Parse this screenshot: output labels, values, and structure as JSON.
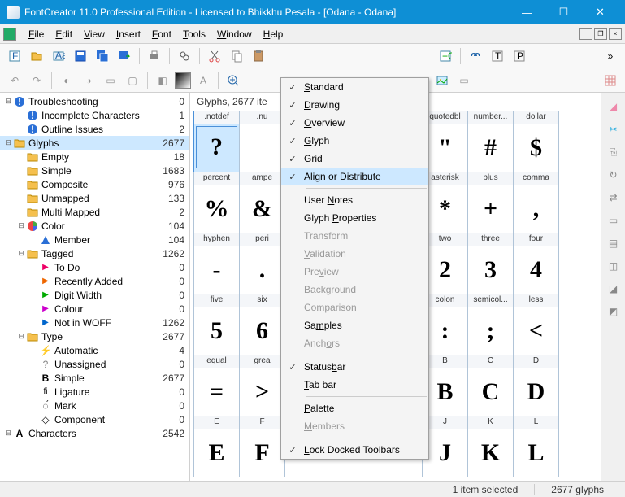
{
  "title": "FontCreator 11.0 Professional Edition - Licensed to Bhikkhu Pesala - [Odana - Odana]",
  "menu": [
    "File",
    "Edit",
    "View",
    "Insert",
    "Font",
    "Tools",
    "Window",
    "Help"
  ],
  "glyphHeader": "Glyphs, 2677 ite",
  "tree": [
    {
      "d": 0,
      "e": "-",
      "i": "info",
      "l": "Troubleshooting",
      "c": 0
    },
    {
      "d": 1,
      "e": "",
      "i": "info",
      "l": "Incomplete Characters",
      "c": 1
    },
    {
      "d": 1,
      "e": "",
      "i": "info",
      "l": "Outline Issues",
      "c": 2
    },
    {
      "d": 0,
      "e": "-",
      "i": "folder",
      "l": "Glyphs",
      "c": 2677,
      "sel": true
    },
    {
      "d": 1,
      "e": "",
      "i": "folder",
      "l": "Empty",
      "c": 18
    },
    {
      "d": 1,
      "e": "",
      "i": "folder",
      "l": "Simple",
      "c": 1683
    },
    {
      "d": 1,
      "e": "",
      "i": "folder",
      "l": "Composite",
      "c": 976
    },
    {
      "d": 1,
      "e": "",
      "i": "folder",
      "l": "Unmapped",
      "c": 133
    },
    {
      "d": 1,
      "e": "",
      "i": "folder",
      "l": "Multi Mapped",
      "c": 2
    },
    {
      "d": 1,
      "e": "-",
      "i": "pie",
      "l": "Color",
      "c": 104
    },
    {
      "d": 2,
      "e": "",
      "i": "tri",
      "l": "Member",
      "c": 104
    },
    {
      "d": 1,
      "e": "-",
      "i": "folder",
      "l": "Tagged",
      "c": 1262
    },
    {
      "d": 2,
      "e": "",
      "i": "flag",
      "fc": "#e06",
      "l": "To Do",
      "c": 0
    },
    {
      "d": 2,
      "e": "",
      "i": "flag",
      "fc": "#e60",
      "l": "Recently Added",
      "c": 0
    },
    {
      "d": 2,
      "e": "",
      "i": "flag",
      "fc": "#0a0",
      "l": "Digit Width",
      "c": 0
    },
    {
      "d": 2,
      "e": "",
      "i": "flag",
      "fc": "#c0c",
      "l": "Colour",
      "c": 0
    },
    {
      "d": 2,
      "e": "",
      "i": "flag",
      "fc": "#06c",
      "l": "Not in WOFF",
      "c": 1262
    },
    {
      "d": 1,
      "e": "-",
      "i": "folder",
      "l": "Type",
      "c": 2677
    },
    {
      "d": 2,
      "e": "",
      "i": "bolt",
      "l": "Automatic",
      "c": 4
    },
    {
      "d": 2,
      "e": "",
      "i": "q",
      "l": "Unassigned",
      "c": 0
    },
    {
      "d": 2,
      "e": "",
      "i": "B",
      "l": "Simple",
      "c": 2677
    },
    {
      "d": 2,
      "e": "",
      "i": "fi",
      "l": "Ligature",
      "c": 0
    },
    {
      "d": 2,
      "e": "",
      "i": "mk",
      "l": "Mark",
      "c": 0
    },
    {
      "d": 2,
      "e": "",
      "i": "cmp",
      "l": "Component",
      "c": 0
    },
    {
      "d": 0,
      "e": "-",
      "i": "A",
      "l": "Characters",
      "c": 2542
    }
  ],
  "grid": [
    [
      {
        "l": ".notdef",
        "g": "?",
        "sel": true
      },
      {
        "l": ".nu",
        "g": ""
      },
      null,
      null,
      null,
      {
        "l": "quotedbl",
        "g": "\""
      },
      {
        "l": "number...",
        "g": "#"
      },
      {
        "l": "dollar",
        "g": "$"
      }
    ],
    [
      {
        "l": "percent",
        "g": "%"
      },
      {
        "l": "ampe",
        "g": "&"
      },
      null,
      null,
      null,
      {
        "l": "asterisk",
        "g": "*"
      },
      {
        "l": "plus",
        "g": "+"
      },
      {
        "l": "comma",
        "g": ","
      }
    ],
    [
      {
        "l": "hyphen",
        "g": "-"
      },
      {
        "l": "peri",
        "g": "."
      },
      null,
      null,
      null,
      {
        "l": "two",
        "g": "2"
      },
      {
        "l": "three",
        "g": "3"
      },
      {
        "l": "four",
        "g": "4"
      }
    ],
    [
      {
        "l": "five",
        "g": "5"
      },
      {
        "l": "six",
        "g": "6"
      },
      null,
      null,
      null,
      {
        "l": "colon",
        "g": ":"
      },
      {
        "l": "semicol...",
        "g": ";"
      },
      {
        "l": "less",
        "g": "<"
      }
    ],
    [
      {
        "l": "equal",
        "g": "="
      },
      {
        "l": "grea",
        "g": ">"
      },
      null,
      null,
      null,
      {
        "l": "B",
        "g": "B"
      },
      {
        "l": "C",
        "g": "C"
      },
      {
        "l": "D",
        "g": "D"
      }
    ],
    [
      {
        "l": "E",
        "g": "E"
      },
      {
        "l": "F",
        "g": "F"
      },
      null,
      null,
      null,
      {
        "l": "J",
        "g": "J"
      },
      {
        "l": "K",
        "g": "K"
      },
      {
        "l": "L",
        "g": "L"
      }
    ]
  ],
  "dropdown": [
    {
      "t": "item",
      "chk": true,
      "l": "Standard",
      "u": 0
    },
    {
      "t": "item",
      "chk": true,
      "l": "Drawing",
      "u": 0
    },
    {
      "t": "item",
      "chk": true,
      "l": "Overview",
      "u": 0
    },
    {
      "t": "item",
      "chk": true,
      "l": "Glyph",
      "u": 0
    },
    {
      "t": "item",
      "chk": true,
      "l": "Grid",
      "u": 0
    },
    {
      "t": "item",
      "chk": true,
      "l": "Align or Distribute",
      "u": 0,
      "hl": true
    },
    {
      "t": "sep"
    },
    {
      "t": "item",
      "l": "User Notes",
      "u": 5
    },
    {
      "t": "item",
      "l": "Glyph Properties",
      "u": 6
    },
    {
      "t": "item",
      "l": "Transform",
      "dis": true
    },
    {
      "t": "item",
      "l": "Validation",
      "dis": true,
      "u": 0
    },
    {
      "t": "item",
      "l": "Preview",
      "dis": true,
      "u": 3
    },
    {
      "t": "item",
      "l": "Background",
      "dis": true,
      "u": 0
    },
    {
      "t": "item",
      "l": "Comparison",
      "dis": true,
      "u": 0
    },
    {
      "t": "item",
      "l": "Samples",
      "u": 2
    },
    {
      "t": "item",
      "l": "Anchors",
      "dis": true,
      "u": 4
    },
    {
      "t": "sep"
    },
    {
      "t": "item",
      "chk": true,
      "l": "Statusbar",
      "u": 6
    },
    {
      "t": "item",
      "l": "Tab bar",
      "u": 0
    },
    {
      "t": "sep"
    },
    {
      "t": "item",
      "l": "Palette",
      "u": 0
    },
    {
      "t": "item",
      "l": "Members",
      "dis": true,
      "u": 0
    },
    {
      "t": "sep"
    },
    {
      "t": "item",
      "chk": true,
      "l": "Lock Docked Toolbars",
      "u": 0
    }
  ],
  "status": {
    "sel": "1 item selected",
    "cnt": "2677 glyphs"
  }
}
